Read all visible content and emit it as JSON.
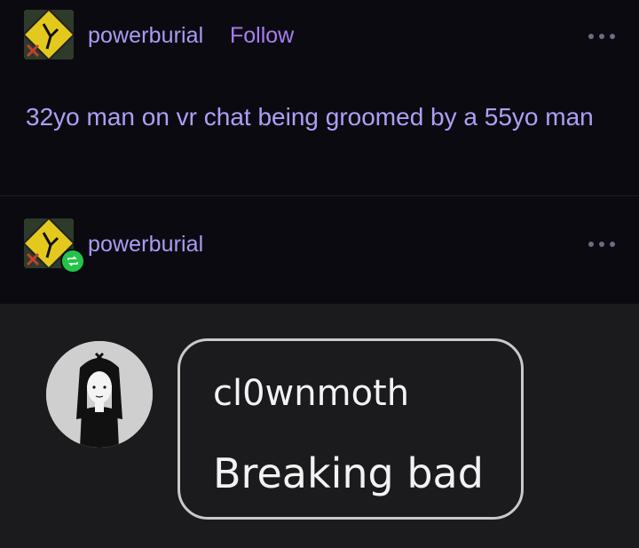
{
  "post1": {
    "username": "powerburial",
    "follow_label": "Follow",
    "text": "32yo man on vr chat being groomed by a 55yo man",
    "more_icon": "ellipsis-icon"
  },
  "post2": {
    "username": "powerburial",
    "reblog_icon": "reblog-icon",
    "more_icon": "ellipsis-icon",
    "comment": {
      "author": "cl0wnmoth",
      "text": "Breaking bad"
    }
  },
  "colors": {
    "background": "#0b0a11",
    "username": "#a99cf2",
    "follow": "#a87df2",
    "post_text": "#ad9ff5",
    "reblog_badge": "#22c54a",
    "image_background": "#1b1b1d"
  }
}
